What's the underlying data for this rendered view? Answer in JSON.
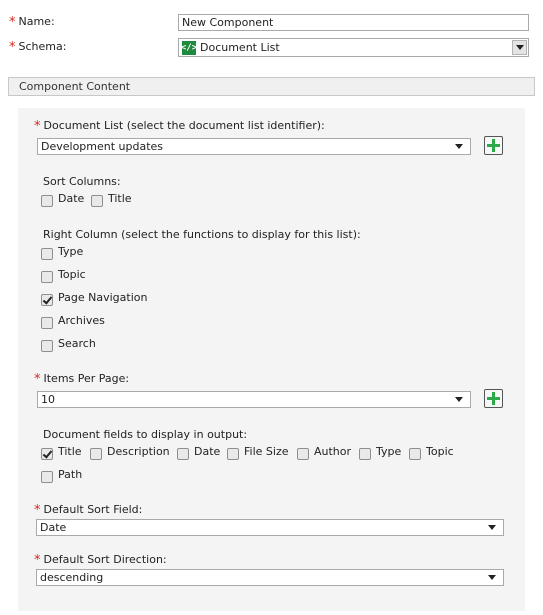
{
  "form": {
    "name_label": "Name:",
    "name_value": "New Component",
    "schema_label": "Schema:",
    "schema_value": "Document List",
    "schema_icon": "code-tag-icon"
  },
  "section": {
    "title": "Component Content"
  },
  "content": {
    "doc_list_label": "Document List (select the document list identifier):",
    "doc_list_value": "Development updates",
    "sort_columns_label": "Sort Columns:",
    "sort_columns": [
      {
        "label": "Date",
        "checked": false
      },
      {
        "label": "Title",
        "checked": false
      }
    ],
    "right_column_label": "Right Column (select the functions to display for this list):",
    "right_column": [
      {
        "label": "Type",
        "checked": false
      },
      {
        "label": "Topic",
        "checked": false
      },
      {
        "label": "Page Navigation",
        "checked": true
      },
      {
        "label": "Archives",
        "checked": false
      },
      {
        "label": "Search",
        "checked": false
      }
    ],
    "items_per_page_label": "Items Per Page:",
    "items_per_page_value": "10",
    "doc_fields_label": "Document fields to display in output:",
    "doc_fields": [
      {
        "label": "Title",
        "checked": true
      },
      {
        "label": "Description",
        "checked": false
      },
      {
        "label": "Date",
        "checked": false
      },
      {
        "label": "File Size",
        "checked": false
      },
      {
        "label": "Author",
        "checked": false
      },
      {
        "label": "Type",
        "checked": false
      },
      {
        "label": "Topic",
        "checked": false
      },
      {
        "label": "Path",
        "checked": false
      }
    ],
    "default_sort_field_label": "Default Sort Field:",
    "default_sort_field_value": "Date",
    "default_sort_direction_label": "Default Sort Direction:",
    "default_sort_direction_value": "descending"
  },
  "colors": {
    "required": "#d9261c",
    "plus": "#2da84a",
    "schema_icon_bg": "#1f8a3e"
  }
}
